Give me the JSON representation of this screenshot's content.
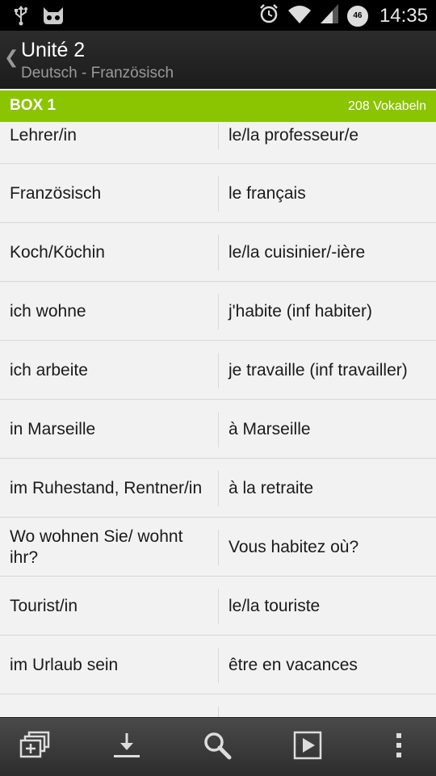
{
  "status_bar": {
    "time": "14:35",
    "battery": "46",
    "icons": [
      "usb-icon",
      "cat-icon",
      "alarm-icon",
      "wifi-icon",
      "signal-icon",
      "battery-icon"
    ]
  },
  "action_bar": {
    "title": "Unité 2",
    "subtitle": "Deutsch - Französisch",
    "back_icon": "chevron-left-icon"
  },
  "box_bar": {
    "label": "BOX 1",
    "count": "208 Vokabeln",
    "color": "#8bc400"
  },
  "vocab": [
    {
      "de": "Lehrer/in",
      "fr": "le/la professeur/e"
    },
    {
      "de": "Französisch",
      "fr": "le français"
    },
    {
      "de": "Koch/Köchin",
      "fr": "le/la cuisinier/-ière"
    },
    {
      "de": "ich wohne",
      "fr": "j'habite (inf habiter)"
    },
    {
      "de": "ich arbeite",
      "fr": "je travaille (inf travailler)"
    },
    {
      "de": "in Marseille",
      "fr": "à Marseille"
    },
    {
      "de": "im Ruhestand, Rentner/in",
      "fr": "à la retraite"
    },
    {
      "de": "Wo wohnen Sie/ wohnt ihr?",
      "fr": "Vous habitez où?"
    },
    {
      "de": "Tourist/in",
      "fr": "le/la touriste"
    },
    {
      "de": "im Urlaub sein",
      "fr": "être en vacances"
    },
    {
      "de": "",
      "fr": ""
    }
  ],
  "bottom_bar": {
    "icons": [
      "add-to-box-icon",
      "download-icon",
      "search-icon",
      "play-icon",
      "overflow-menu-icon"
    ]
  }
}
